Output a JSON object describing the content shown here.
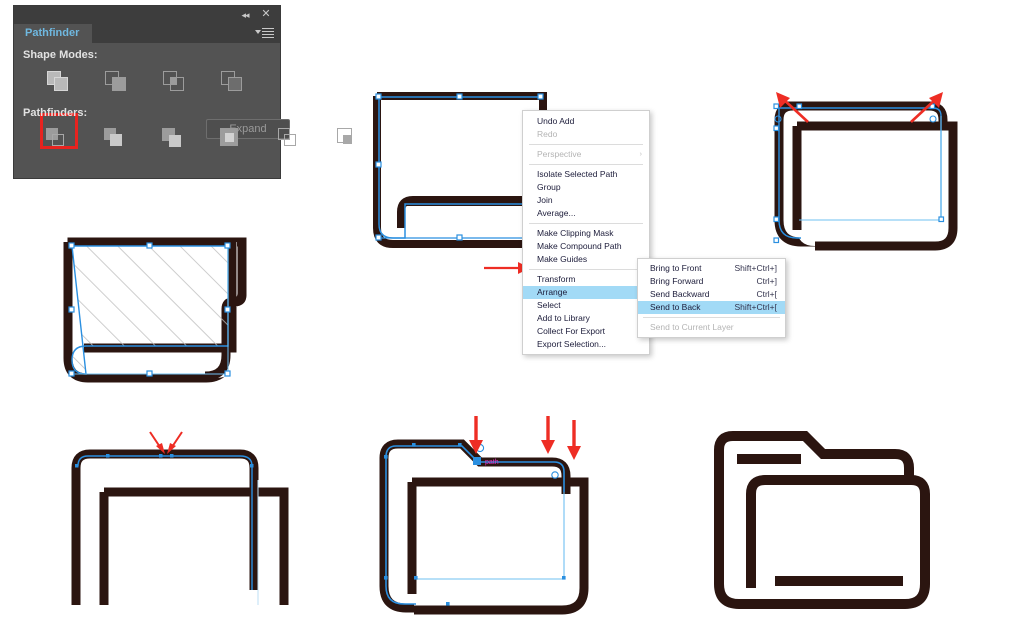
{
  "panel": {
    "title": "Pathfinder",
    "collapse_icon": "collapse-double-chevron-icon",
    "close_icon": "close-icon",
    "menu_icon": "panel-menu-icon",
    "shape_modes_label": "Shape Modes:",
    "pathfinders_label": "Pathfinders:",
    "expand_label": "Expand",
    "shape_modes": [
      {
        "name": "unite",
        "selected": true
      },
      {
        "name": "minus-front",
        "selected": false
      },
      {
        "name": "intersect",
        "selected": false
      },
      {
        "name": "exclude",
        "selected": false
      }
    ],
    "pathfinders": [
      {
        "name": "divide"
      },
      {
        "name": "trim"
      },
      {
        "name": "merge"
      },
      {
        "name": "crop"
      },
      {
        "name": "outline"
      },
      {
        "name": "minus-back"
      }
    ],
    "selection_highlight_color": "#e8231f",
    "panel_bg": "#535353",
    "tab_text_color": "#6fb8e0"
  },
  "context_menu": {
    "highlight_color": "#a2daf6",
    "items": [
      {
        "label": "Undo Add",
        "disabled": false,
        "submenu": false,
        "highlighted": false
      },
      {
        "label": "Redo",
        "disabled": true,
        "submenu": false,
        "highlighted": false
      },
      {
        "sep": true
      },
      {
        "label": "Perspective",
        "disabled": true,
        "submenu": true,
        "highlighted": false
      },
      {
        "sep": true
      },
      {
        "label": "Isolate Selected Path",
        "disabled": false,
        "submenu": false,
        "highlighted": false
      },
      {
        "label": "Group",
        "disabled": false,
        "submenu": false,
        "highlighted": false
      },
      {
        "label": "Join",
        "disabled": false,
        "submenu": false,
        "highlighted": false
      },
      {
        "label": "Average...",
        "disabled": false,
        "submenu": false,
        "highlighted": false
      },
      {
        "sep": true
      },
      {
        "label": "Make Clipping Mask",
        "disabled": false,
        "submenu": false,
        "highlighted": false
      },
      {
        "label": "Make Compound Path",
        "disabled": false,
        "submenu": false,
        "highlighted": false
      },
      {
        "label": "Make Guides",
        "disabled": false,
        "submenu": false,
        "highlighted": false
      },
      {
        "sep": true
      },
      {
        "label": "Transform",
        "disabled": false,
        "submenu": true,
        "highlighted": false
      },
      {
        "label": "Arrange",
        "disabled": false,
        "submenu": true,
        "highlighted": true
      },
      {
        "label": "Select",
        "disabled": false,
        "submenu": true,
        "highlighted": false
      },
      {
        "label": "Add to Library",
        "disabled": false,
        "submenu": false,
        "highlighted": false
      },
      {
        "label": "Collect For Export",
        "disabled": false,
        "submenu": false,
        "highlighted": false
      },
      {
        "label": "Export Selection...",
        "disabled": false,
        "submenu": false,
        "highlighted": false
      }
    ]
  },
  "arrange_submenu": {
    "items": [
      {
        "label": "Bring to Front",
        "shortcut": "Shift+Ctrl+]",
        "disabled": false,
        "highlighted": false
      },
      {
        "label": "Bring Forward",
        "shortcut": "Ctrl+]",
        "disabled": false,
        "highlighted": false
      },
      {
        "label": "Send Backward",
        "shortcut": "Ctrl+[",
        "disabled": false,
        "highlighted": false
      },
      {
        "label": "Send to Back",
        "shortcut": "Shift+Ctrl+[",
        "disabled": false,
        "highlighted": true
      },
      {
        "sep": true
      },
      {
        "label": "Send to Current Layer",
        "shortcut": "",
        "disabled": true,
        "highlighted": false
      }
    ]
  },
  "artwork": {
    "stroke_color": "#2b1510",
    "selection_color": "#2a8fe0",
    "anchor_color": "#2a8fe0",
    "smart_guide_label": "path",
    "smart_guide_color": "#e734c8",
    "annotation_arrow_color": "#ee2d24",
    "steps": [
      {
        "id": "step-1-selected-folder-back",
        "caption": ""
      },
      {
        "id": "step-2-two-shapes-corners",
        "caption": ""
      },
      {
        "id": "step-3-hatched-selection",
        "caption": ""
      },
      {
        "id": "step-4-anchor-points-top",
        "caption": ""
      },
      {
        "id": "step-5-tab-path-drawn",
        "caption": ""
      },
      {
        "id": "step-6-final-folder-icon",
        "caption": ""
      }
    ]
  }
}
